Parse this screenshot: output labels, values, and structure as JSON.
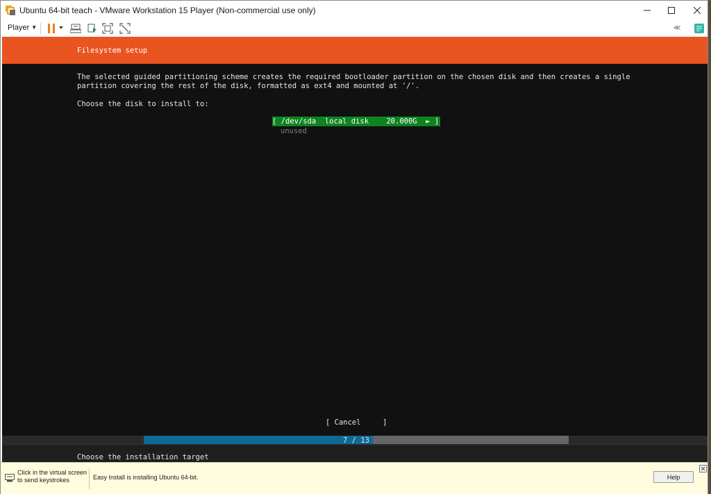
{
  "window": {
    "title": "Ubuntu 64-bit teach - VMware Workstation 15 Player (Non-commercial use only)"
  },
  "toolbar": {
    "player_label": "Player",
    "icons": [
      "pause-icon",
      "send-ctrl-alt-del-icon",
      "removable-devices-icon",
      "fit-guest-icon",
      "unity-icon",
      "collapse-icon",
      "library-icon"
    ]
  },
  "installer": {
    "header_title": "Filesystem setup",
    "description_line1": "The selected guided partitioning scheme creates the required bootloader partition on the chosen disk and then creates a single",
    "description_line2": "partition covering the rest of the disk, formatted as ext4 and mounted at '/'.",
    "choose_label": "Choose the disk to install to:",
    "disk_entry": "[ /dev/sda  local disk    20.000G  ► ]",
    "disk_sub": "unused",
    "cancel_button": "[ Cancel     ]",
    "progress": {
      "text": "7 / 13",
      "current": 7,
      "total": 13
    },
    "footer": "Choose the installation target"
  },
  "statusbar": {
    "hint_line1": "Click in the virtual screen",
    "hint_line2": "to send keystrokes",
    "message": "Easy Install is installing Ubuntu 64-bit.",
    "help_button": "Help"
  },
  "colors": {
    "header": "#e95420",
    "selected_disk": "#0e8420",
    "progress_fill": "#0f6a96",
    "progress_track": "#666666",
    "screen_bg": "#111111",
    "statusbar_bg": "#fffdde"
  }
}
